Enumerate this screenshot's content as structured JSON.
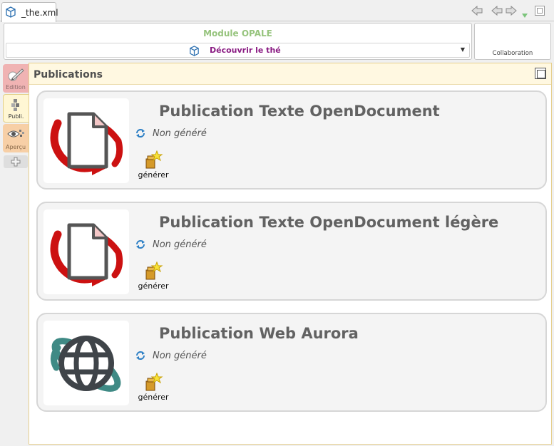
{
  "tab": {
    "title": "_the.xml"
  },
  "header": {
    "module_title": "Module OPALE",
    "selected_item": "Découvrir le thé",
    "collaboration_label": "Collaboration"
  },
  "side_tabs": [
    {
      "label": "Edition"
    },
    {
      "label": "Publi."
    },
    {
      "label": "Aperçu"
    }
  ],
  "panel": {
    "title": "Publications"
  },
  "publications": [
    {
      "title": "Publication Texte OpenDocument",
      "status": "Non généré",
      "action_label": "générer",
      "icon": "opendocument-icon"
    },
    {
      "title": "Publication Texte OpenDocument légère",
      "status": "Non généré",
      "action_label": "générer",
      "icon": "opendocument-icon"
    },
    {
      "title": "Publication Web Aurora",
      "status": "Non généré",
      "action_label": "générer",
      "icon": "globe-icon"
    }
  ],
  "colors": {
    "module_title": "#97c47e",
    "selected_item": "#8a1c83",
    "panel_border": "#e6cf8d",
    "opendocument_red": "#cc1111",
    "globe_teal": "#3f8a85"
  }
}
